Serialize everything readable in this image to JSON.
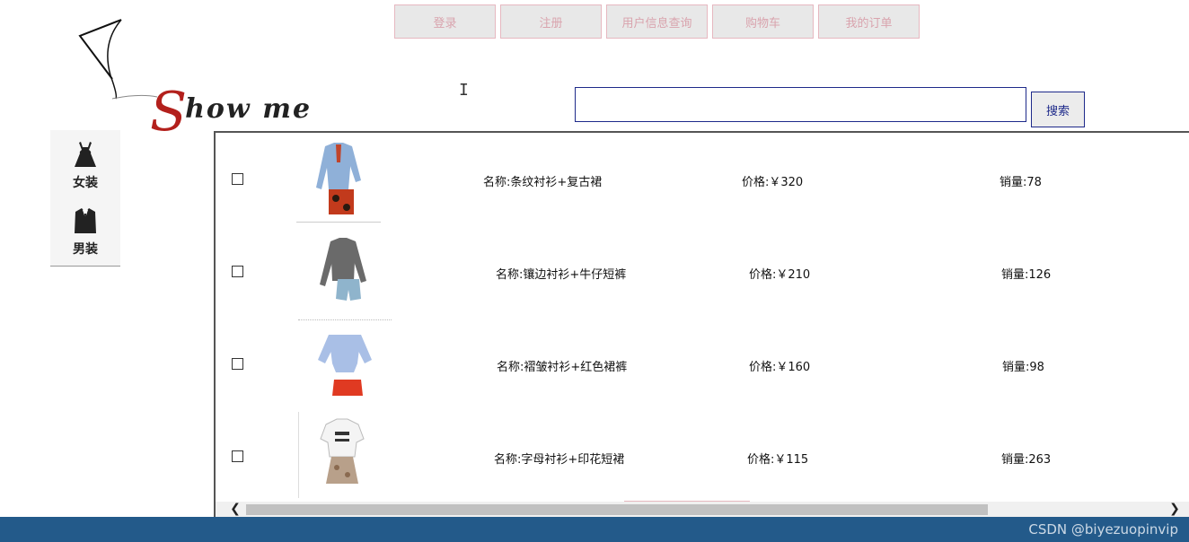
{
  "nav": {
    "items": [
      {
        "label": "登录"
      },
      {
        "label": "注册"
      },
      {
        "label": "用户信息查询"
      },
      {
        "label": "购物车"
      },
      {
        "label": "我的订单"
      }
    ]
  },
  "logo": {
    "text_rest": "how me",
    "text_initial": "S"
  },
  "search": {
    "value": "",
    "placeholder": "",
    "button_label": "搜索"
  },
  "sidebar": {
    "items": [
      {
        "label": "女装",
        "icon": "dress-icon"
      },
      {
        "label": "男装",
        "icon": "suit-icon"
      }
    ]
  },
  "products": [
    {
      "name": "名称:条纹衬衫+复古裙",
      "price": "价格:￥320",
      "sales": "销量:78",
      "checked": false
    },
    {
      "name": "名称:镶边衬衫+牛仔短裤",
      "price": "价格:￥210",
      "sales": "销量:126",
      "checked": false
    },
    {
      "name": "名称:褶皱衬衫+红色裙裤",
      "price": "价格:￥160",
      "sales": "销量:98",
      "checked": false
    },
    {
      "name": "名称:字母衬衫+印花短裙",
      "price": "价格:￥115",
      "sales": "销量:263",
      "checked": false
    }
  ],
  "watermark": "CSDN @biyezuopinvip",
  "colors": {
    "accent": "#1e2a8a",
    "nav_text": "#d9a3ad",
    "footer": "#235a8a",
    "logo_red": "#b3201c"
  }
}
